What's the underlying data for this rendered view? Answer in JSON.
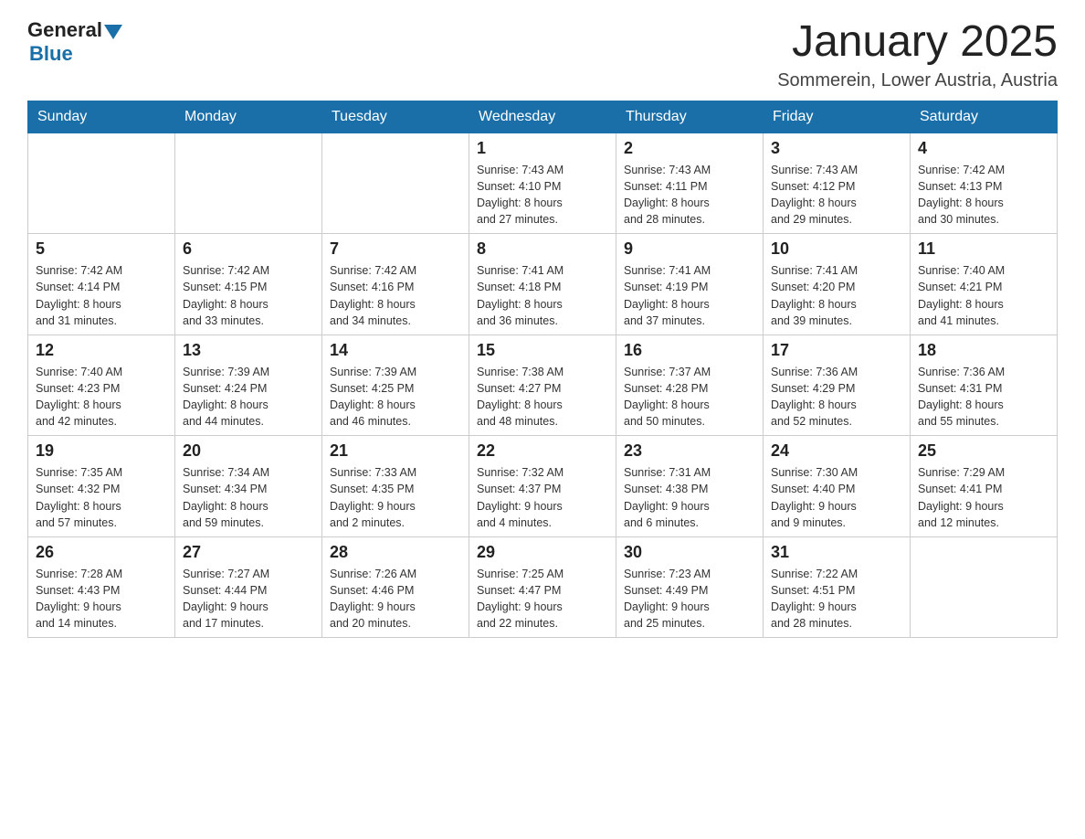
{
  "header": {
    "logo_general": "General",
    "logo_blue": "Blue",
    "month_title": "January 2025",
    "location": "Sommerein, Lower Austria, Austria"
  },
  "days_of_week": [
    "Sunday",
    "Monday",
    "Tuesday",
    "Wednesday",
    "Thursday",
    "Friday",
    "Saturday"
  ],
  "weeks": [
    [
      {
        "day": "",
        "info": ""
      },
      {
        "day": "",
        "info": ""
      },
      {
        "day": "",
        "info": ""
      },
      {
        "day": "1",
        "info": "Sunrise: 7:43 AM\nSunset: 4:10 PM\nDaylight: 8 hours\nand 27 minutes."
      },
      {
        "day": "2",
        "info": "Sunrise: 7:43 AM\nSunset: 4:11 PM\nDaylight: 8 hours\nand 28 minutes."
      },
      {
        "day": "3",
        "info": "Sunrise: 7:43 AM\nSunset: 4:12 PM\nDaylight: 8 hours\nand 29 minutes."
      },
      {
        "day": "4",
        "info": "Sunrise: 7:42 AM\nSunset: 4:13 PM\nDaylight: 8 hours\nand 30 minutes."
      }
    ],
    [
      {
        "day": "5",
        "info": "Sunrise: 7:42 AM\nSunset: 4:14 PM\nDaylight: 8 hours\nand 31 minutes."
      },
      {
        "day": "6",
        "info": "Sunrise: 7:42 AM\nSunset: 4:15 PM\nDaylight: 8 hours\nand 33 minutes."
      },
      {
        "day": "7",
        "info": "Sunrise: 7:42 AM\nSunset: 4:16 PM\nDaylight: 8 hours\nand 34 minutes."
      },
      {
        "day": "8",
        "info": "Sunrise: 7:41 AM\nSunset: 4:18 PM\nDaylight: 8 hours\nand 36 minutes."
      },
      {
        "day": "9",
        "info": "Sunrise: 7:41 AM\nSunset: 4:19 PM\nDaylight: 8 hours\nand 37 minutes."
      },
      {
        "day": "10",
        "info": "Sunrise: 7:41 AM\nSunset: 4:20 PM\nDaylight: 8 hours\nand 39 minutes."
      },
      {
        "day": "11",
        "info": "Sunrise: 7:40 AM\nSunset: 4:21 PM\nDaylight: 8 hours\nand 41 minutes."
      }
    ],
    [
      {
        "day": "12",
        "info": "Sunrise: 7:40 AM\nSunset: 4:23 PM\nDaylight: 8 hours\nand 42 minutes."
      },
      {
        "day": "13",
        "info": "Sunrise: 7:39 AM\nSunset: 4:24 PM\nDaylight: 8 hours\nand 44 minutes."
      },
      {
        "day": "14",
        "info": "Sunrise: 7:39 AM\nSunset: 4:25 PM\nDaylight: 8 hours\nand 46 minutes."
      },
      {
        "day": "15",
        "info": "Sunrise: 7:38 AM\nSunset: 4:27 PM\nDaylight: 8 hours\nand 48 minutes."
      },
      {
        "day": "16",
        "info": "Sunrise: 7:37 AM\nSunset: 4:28 PM\nDaylight: 8 hours\nand 50 minutes."
      },
      {
        "day": "17",
        "info": "Sunrise: 7:36 AM\nSunset: 4:29 PM\nDaylight: 8 hours\nand 52 minutes."
      },
      {
        "day": "18",
        "info": "Sunrise: 7:36 AM\nSunset: 4:31 PM\nDaylight: 8 hours\nand 55 minutes."
      }
    ],
    [
      {
        "day": "19",
        "info": "Sunrise: 7:35 AM\nSunset: 4:32 PM\nDaylight: 8 hours\nand 57 minutes."
      },
      {
        "day": "20",
        "info": "Sunrise: 7:34 AM\nSunset: 4:34 PM\nDaylight: 8 hours\nand 59 minutes."
      },
      {
        "day": "21",
        "info": "Sunrise: 7:33 AM\nSunset: 4:35 PM\nDaylight: 9 hours\nand 2 minutes."
      },
      {
        "day": "22",
        "info": "Sunrise: 7:32 AM\nSunset: 4:37 PM\nDaylight: 9 hours\nand 4 minutes."
      },
      {
        "day": "23",
        "info": "Sunrise: 7:31 AM\nSunset: 4:38 PM\nDaylight: 9 hours\nand 6 minutes."
      },
      {
        "day": "24",
        "info": "Sunrise: 7:30 AM\nSunset: 4:40 PM\nDaylight: 9 hours\nand 9 minutes."
      },
      {
        "day": "25",
        "info": "Sunrise: 7:29 AM\nSunset: 4:41 PM\nDaylight: 9 hours\nand 12 minutes."
      }
    ],
    [
      {
        "day": "26",
        "info": "Sunrise: 7:28 AM\nSunset: 4:43 PM\nDaylight: 9 hours\nand 14 minutes."
      },
      {
        "day": "27",
        "info": "Sunrise: 7:27 AM\nSunset: 4:44 PM\nDaylight: 9 hours\nand 17 minutes."
      },
      {
        "day": "28",
        "info": "Sunrise: 7:26 AM\nSunset: 4:46 PM\nDaylight: 9 hours\nand 20 minutes."
      },
      {
        "day": "29",
        "info": "Sunrise: 7:25 AM\nSunset: 4:47 PM\nDaylight: 9 hours\nand 22 minutes."
      },
      {
        "day": "30",
        "info": "Sunrise: 7:23 AM\nSunset: 4:49 PM\nDaylight: 9 hours\nand 25 minutes."
      },
      {
        "day": "31",
        "info": "Sunrise: 7:22 AM\nSunset: 4:51 PM\nDaylight: 9 hours\nand 28 minutes."
      },
      {
        "day": "",
        "info": ""
      }
    ]
  ]
}
